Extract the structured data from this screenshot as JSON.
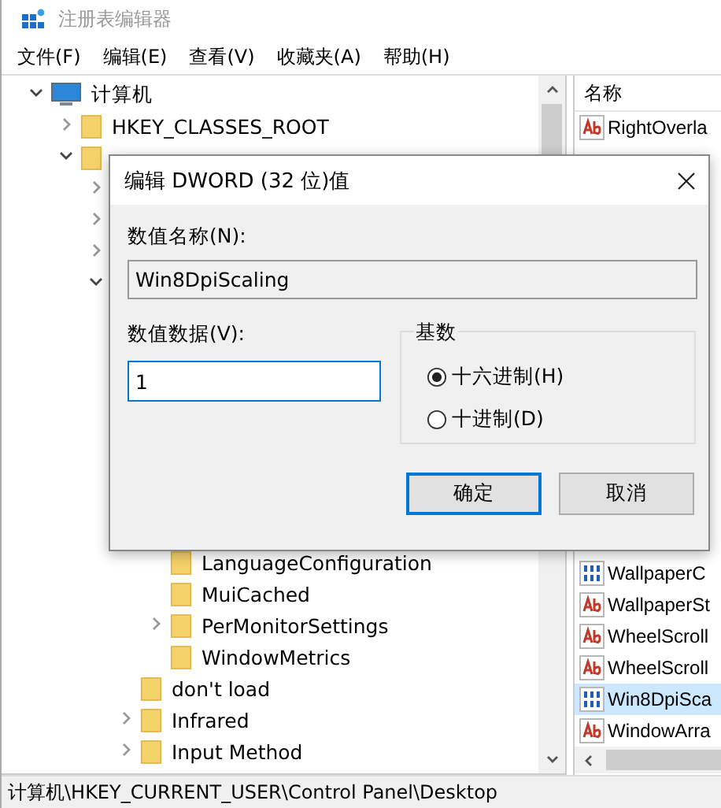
{
  "window": {
    "title": "注册表编辑器"
  },
  "menu": [
    "文件(F)",
    "编辑(E)",
    "查看(V)",
    "收藏夹(A)",
    "帮助(H)"
  ],
  "tree": [
    {
      "label": "计算机",
      "kind": "computer",
      "expanded": true,
      "children": [
        {
          "label": "HKEY_CLASSES_ROOT",
          "kind": "folder",
          "expanded": false
        },
        {
          "kind": "folder",
          "expanded": true,
          "children": [
            {
              "expanded": false
            },
            {
              "expanded": false
            },
            {
              "expanded": false
            },
            {
              "expanded": true,
              "children": [
                {
                  "children": [
                    {
                      "label": "LanguageConfiguration",
                      "kind": "folder"
                    },
                    {
                      "label": "MuiCached",
                      "kind": "folder"
                    },
                    {
                      "label": "PerMonitorSettings",
                      "kind": "folder",
                      "expanded": false
                    },
                    {
                      "label": "WindowMetrics",
                      "kind": "folder"
                    }
                  ]
                },
                {
                  "label": "don't load",
                  "kind": "folder"
                },
                {
                  "label": "Infrared",
                  "kind": "folder",
                  "expanded": false
                },
                {
                  "label": "Input Method",
                  "kind": "folder",
                  "expanded": false
                }
              ]
            }
          ]
        }
      ]
    }
  ],
  "values": {
    "header": "名称",
    "items": [
      {
        "name": "RightOverla",
        "kind": "string",
        "selected": false
      },
      {
        "name": "WallpaperC",
        "kind": "dword",
        "selected": false
      },
      {
        "name": "WallpaperSt",
        "kind": "string",
        "selected": false
      },
      {
        "name": "WheelScroll",
        "kind": "string",
        "selected": false
      },
      {
        "name": "WheelScroll",
        "kind": "string",
        "selected": false
      },
      {
        "name": "Win8DpiSca",
        "kind": "dword",
        "selected": true
      },
      {
        "name": "WindowArra",
        "kind": "string",
        "selected": false
      }
    ]
  },
  "status_bar": "计算机\\HKEY_CURRENT_USER\\Control Panel\\Desktop",
  "dialog": {
    "title": "编辑 DWORD (32 位)值",
    "name_label": "数值名称(N):",
    "name_value": "Win8DpiScaling",
    "data_label": "数值数据(V):",
    "data_value": "1",
    "base_label": "基数",
    "bases": [
      {
        "label": "十六进制(H)",
        "selected": true
      },
      {
        "label": "十进制(D)",
        "selected": false
      }
    ],
    "buttons": [
      {
        "label": "确定",
        "default": true
      },
      {
        "label": "取消",
        "default": false
      }
    ]
  }
}
